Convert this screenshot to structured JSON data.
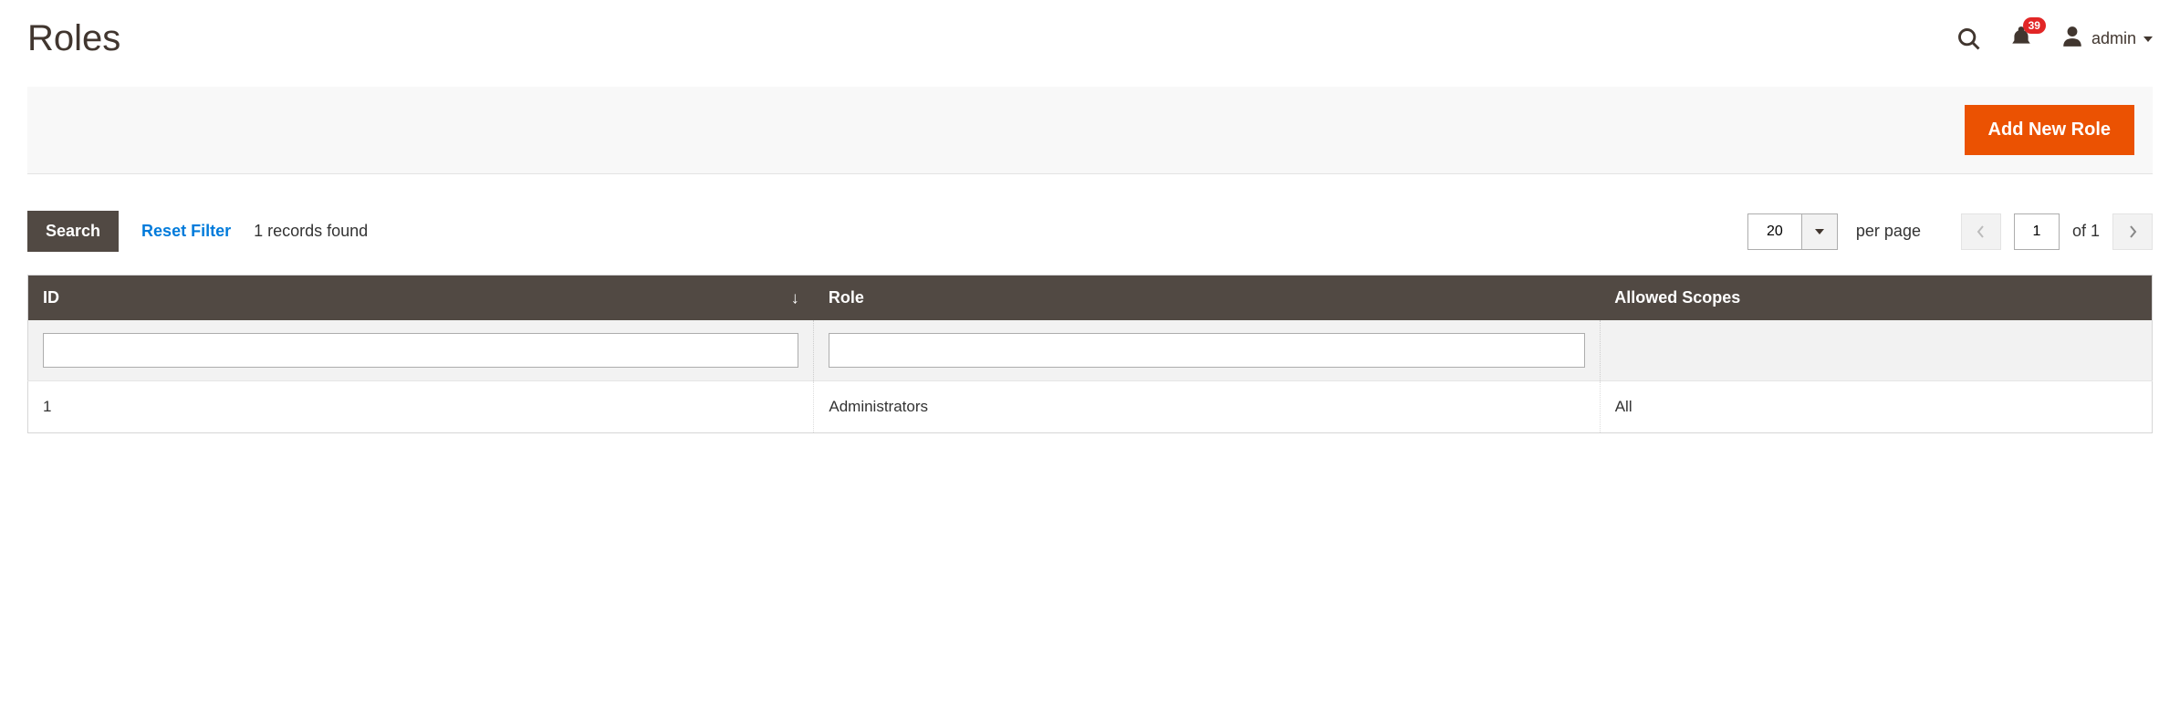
{
  "header": {
    "title": "Roles",
    "notification_count": "39",
    "username": "admin"
  },
  "actions": {
    "add_new_role": "Add New Role"
  },
  "toolbar": {
    "search_label": "Search",
    "reset_label": "Reset Filter",
    "records_found": "1 records found",
    "per_page_value": "20",
    "per_page_label": "per page",
    "current_page": "1",
    "of_label": "of 1"
  },
  "grid": {
    "columns": {
      "id": "ID",
      "role": "Role",
      "scopes": "Allowed Scopes"
    },
    "filters": {
      "id": "",
      "role": ""
    },
    "rows": [
      {
        "id": "1",
        "role": "Administrators",
        "scopes": "All"
      }
    ]
  }
}
